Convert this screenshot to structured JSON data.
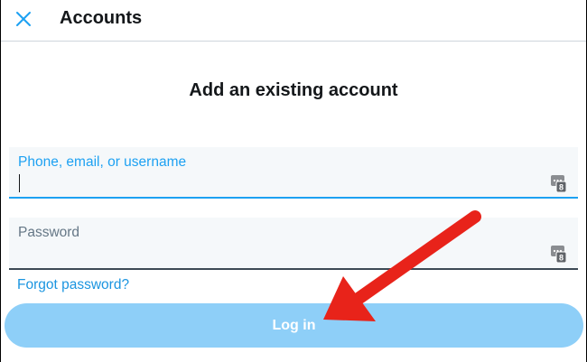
{
  "header": {
    "title": "Accounts",
    "close_icon": "close-icon"
  },
  "main": {
    "heading": "Add an existing account",
    "phone_field": {
      "label": "Phone, email, or username",
      "value": "",
      "icon": "password-manager-key-icon"
    },
    "password_field": {
      "label": "Password",
      "value": "",
      "icon": "password-manager-key-icon"
    },
    "forgot_link": "Forgot password?",
    "login_button": "Log in"
  },
  "colors": {
    "accent": "#1da1f2",
    "link": "#1b95e0",
    "button_disabled": "#8ecff8",
    "annotation_arrow": "#e8231a"
  }
}
